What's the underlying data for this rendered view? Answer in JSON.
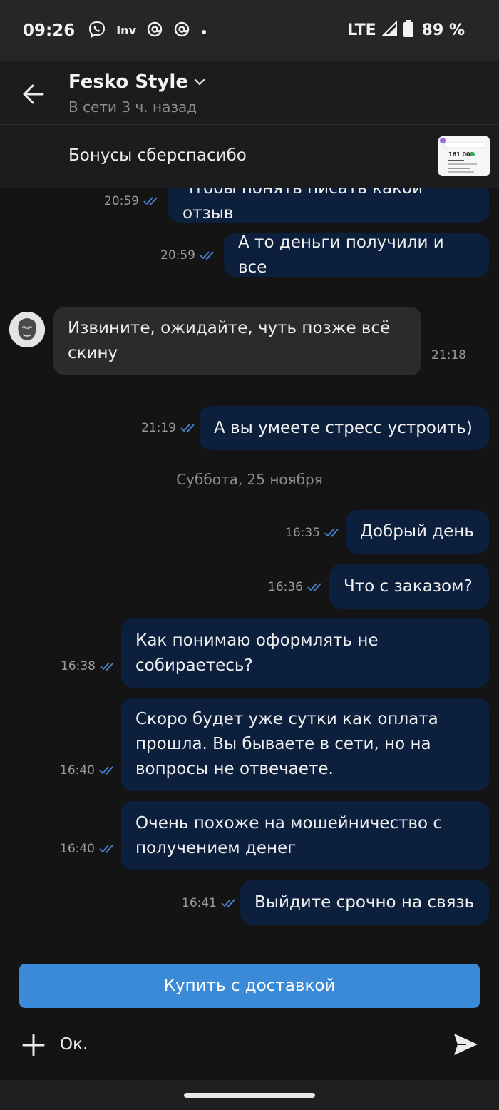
{
  "status_bar": {
    "time": "09:26",
    "network": "LTE",
    "battery": "89 %",
    "app_icons": [
      "viber-icon",
      "inv-icon",
      "at-icon",
      "at-icon",
      "dot-icon"
    ],
    "inv_text": "Inv"
  },
  "header": {
    "title": "Fesko Style",
    "subtitle": "В сети 3 ч. назад"
  },
  "listing": {
    "title": "Бонусы сберспасибо",
    "thumb_value": "161 008"
  },
  "messages": [
    {
      "dir": "out",
      "text": "Чтобы понять писать какой отзыв",
      "time": "20:59"
    },
    {
      "dir": "out",
      "text": "А то деньги получили и все",
      "time": "20:59"
    },
    {
      "dir": "in",
      "text": "Извините, ожидайте, чуть позже всё скину",
      "time": "21:18"
    },
    {
      "dir": "out",
      "text": "А вы умеете стресс устроить)",
      "time": "21:19"
    },
    {
      "dir": "out",
      "text": "Добрый день",
      "time": "16:35"
    },
    {
      "dir": "out",
      "text": "Что с заказом?",
      "time": "16:36"
    },
    {
      "dir": "out",
      "text": "Как понимаю оформлять не собираетесь?",
      "time": "16:38"
    },
    {
      "dir": "out",
      "text": "Скоро будет уже сутки как оплата прошла. Вы бываете в сети, но на вопросы не отвечаете.",
      "time": "16:40"
    },
    {
      "dir": "out",
      "text": "Очень похоже на мошейничество с получением денег",
      "time": "16:40"
    },
    {
      "dir": "out",
      "text": "Выйдите срочно на связь",
      "time": "16:41"
    }
  ],
  "day_separator": "Суббота, 25 ноября",
  "buy_button": "Купить с доставкой",
  "composer": {
    "value": "Ок."
  },
  "colors": {
    "outgoing_bubble": "#0c1f3d",
    "incoming_bubble": "#2b2b2b",
    "accent": "#3b8ad8",
    "read_check": "#4a86d6"
  }
}
